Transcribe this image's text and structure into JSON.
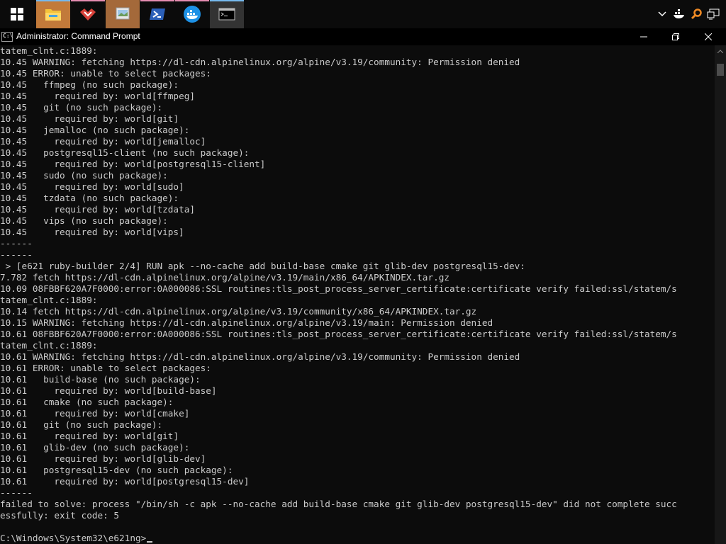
{
  "taskbar": {
    "apps": [
      {
        "name": "file-explorer",
        "icon": "folder-icon",
        "state": "active"
      },
      {
        "name": "git-gui",
        "icon": "git-diamond-icon",
        "state": "pinned"
      },
      {
        "name": "image-app",
        "icon": "picture-icon",
        "state": "active"
      },
      {
        "name": "powershell",
        "icon": "powershell-icon",
        "state": "pinned"
      },
      {
        "name": "docker-desktop",
        "icon": "docker-whale-icon",
        "state": "pinned"
      },
      {
        "name": "command-prompt",
        "icon": "cmd-icon",
        "state": "active"
      }
    ],
    "tray_icons": [
      "chevron-up-icon",
      "docker-tray-icon",
      "search-tray-icon",
      "network-icon"
    ]
  },
  "window": {
    "title": "Administrator: Command Prompt",
    "icon_glyph": "C:\\",
    "controls": {
      "minimize": "minimize",
      "maximize": "restore",
      "close": "close"
    }
  },
  "console": {
    "lines": [
      "tatem_clnt.c:1889:",
      "10.45 WARNING: fetching https://dl-cdn.alpinelinux.org/alpine/v3.19/community: Permission denied",
      "10.45 ERROR: unable to select packages:",
      "10.45   ffmpeg (no such package):",
      "10.45     required by: world[ffmpeg]",
      "10.45   git (no such package):",
      "10.45     required by: world[git]",
      "10.45   jemalloc (no such package):",
      "10.45     required by: world[jemalloc]",
      "10.45   postgresql15-client (no such package):",
      "10.45     required by: world[postgresql15-client]",
      "10.45   sudo (no such package):",
      "10.45     required by: world[sudo]",
      "10.45   tzdata (no such package):",
      "10.45     required by: world[tzdata]",
      "10.45   vips (no such package):",
      "10.45     required by: world[vips]",
      "------",
      "------",
      " > [e621 ruby-builder 2/4] RUN apk --no-cache add build-base cmake git glib-dev postgresql15-dev:",
      "7.782 fetch https://dl-cdn.alpinelinux.org/alpine/v3.19/main/x86_64/APKINDEX.tar.gz",
      "10.09 08FBBF620A7F0000:error:0A000086:SSL routines:tls_post_process_server_certificate:certificate verify failed:ssl/statem/s",
      "tatem_clnt.c:1889:",
      "10.14 fetch https://dl-cdn.alpinelinux.org/alpine/v3.19/community/x86_64/APKINDEX.tar.gz",
      "10.15 WARNING: fetching https://dl-cdn.alpinelinux.org/alpine/v3.19/main: Permission denied",
      "10.61 08FBBF620A7F0000:error:0A000086:SSL routines:tls_post_process_server_certificate:certificate verify failed:ssl/statem/s",
      "tatem_clnt.c:1889:",
      "10.61 WARNING: fetching https://dl-cdn.alpinelinux.org/alpine/v3.19/community: Permission denied",
      "10.61 ERROR: unable to select packages:",
      "10.61   build-base (no such package):",
      "10.61     required by: world[build-base]",
      "10.61   cmake (no such package):",
      "10.61     required by: world[cmake]",
      "10.61   git (no such package):",
      "10.61     required by: world[git]",
      "10.61   glib-dev (no such package):",
      "10.61     required by: world[glib-dev]",
      "10.61   postgresql15-dev (no such package):",
      "10.61     required by: world[postgresql15-dev]",
      "------",
      "failed to solve: process \"/bin/sh -c apk --no-cache add build-base cmake git glib-dev postgresql15-dev\" did not complete succ",
      "essfully: exit code: 5",
      ""
    ],
    "prompt": "C:\\Windows\\System32\\e621ng>"
  },
  "colors": {
    "console_bg": "#0c0c0c",
    "console_fg": "#cccccc",
    "taskbar_bg": "#0b0b0b"
  }
}
